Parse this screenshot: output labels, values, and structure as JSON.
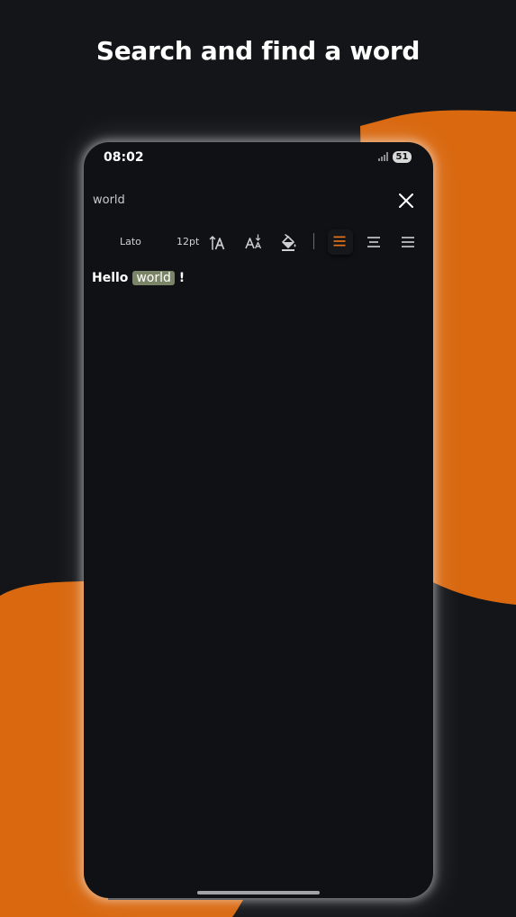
{
  "headline": "Search and find a word",
  "status_bar": {
    "time": "08:02",
    "battery": "51"
  },
  "search": {
    "query": "world",
    "close_icon": "close-icon"
  },
  "toolbar": {
    "font_name": "Lato",
    "font_size": "12pt",
    "icons": [
      "font-size-icon",
      "font-spacing-icon",
      "fill-color-icon",
      "align-left-icon",
      "align-center-icon",
      "align-right-icon"
    ],
    "active_alignment": "left",
    "accent_color": "#E8731B"
  },
  "document": {
    "before": "Hello ",
    "match": "world",
    "after": " !"
  },
  "colors": {
    "background": "#131519",
    "blob": "#D9680F",
    "highlight": "#7A8466"
  }
}
